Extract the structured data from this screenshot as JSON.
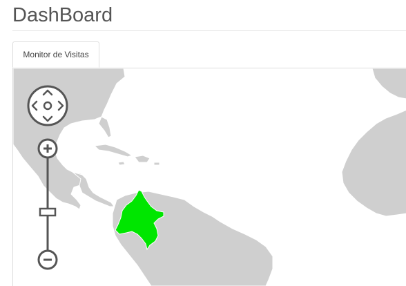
{
  "header": {
    "title": "DashBoard"
  },
  "tabs": [
    {
      "label": "Monitor de Visitas",
      "active": true
    }
  ],
  "map": {
    "highlighted_country": "colombia",
    "highlight_color": "#00e600",
    "land_color": "#cfcfcf",
    "ocean_color": "#ffffff",
    "controls": {
      "pan": "pan-control-icon",
      "zoom_in": "zoom-in-icon",
      "zoom_out": "zoom-out-icon",
      "zoom_slider": "zoom-slider"
    }
  }
}
